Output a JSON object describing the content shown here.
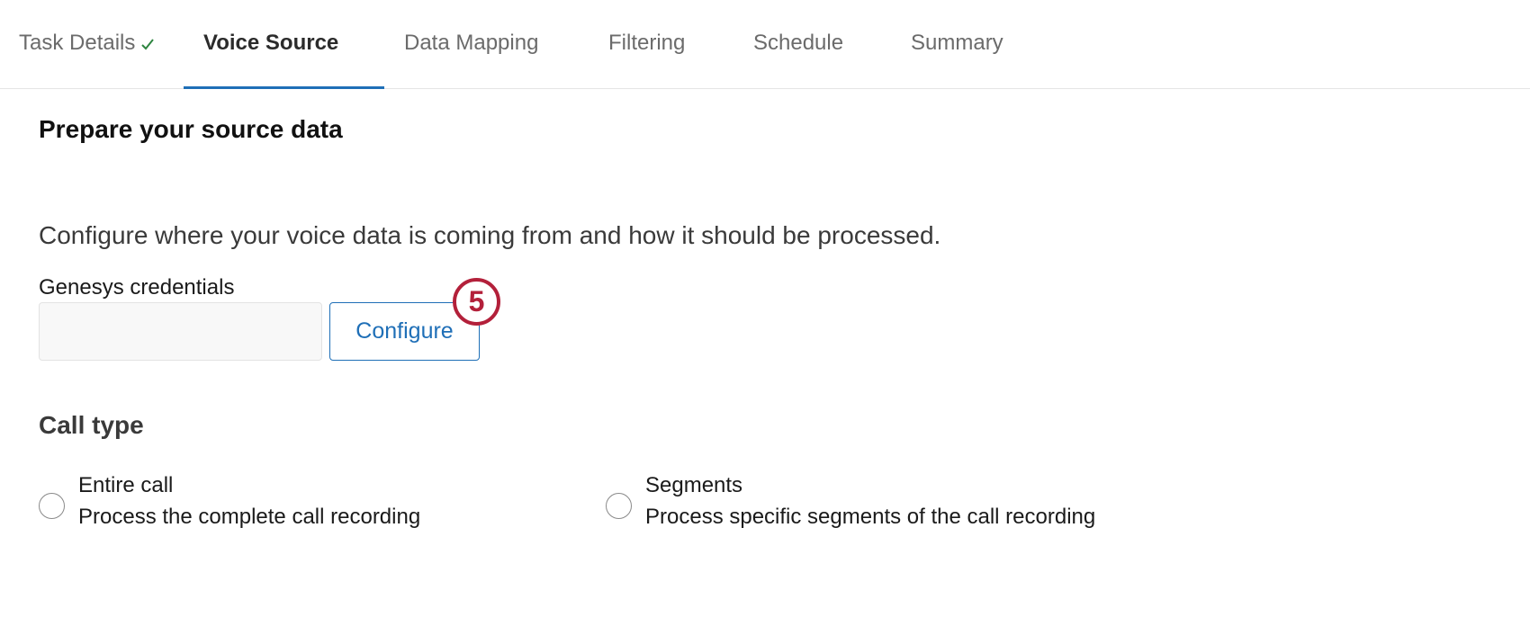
{
  "tabs": [
    {
      "label": "Task Details",
      "completed": true,
      "active": false
    },
    {
      "label": "Voice Source",
      "completed": false,
      "active": true
    },
    {
      "label": "Data Mapping",
      "completed": false,
      "active": false
    },
    {
      "label": "Filtering",
      "completed": false,
      "active": false
    },
    {
      "label": "Schedule",
      "completed": false,
      "active": false
    },
    {
      "label": "Summary",
      "completed": false,
      "active": false
    }
  ],
  "main": {
    "title": "Prepare your source data",
    "description": "Configure where your voice data is coming from and how it should be processed.",
    "credentials": {
      "label": "Genesys credentials",
      "value": "",
      "button_label": "Configure"
    },
    "step_badge": "5",
    "call_type": {
      "title": "Call type",
      "options": [
        {
          "title": "Entire call",
          "description": "Process the complete call recording",
          "selected": false
        },
        {
          "title": "Segments",
          "description": "Process specific segments of the call recording",
          "selected": false
        }
      ]
    }
  },
  "colors": {
    "accent": "#1f6fb7",
    "badge": "#b3203a",
    "check": "#2e8540"
  },
  "icons": {
    "completed": "check-icon"
  }
}
